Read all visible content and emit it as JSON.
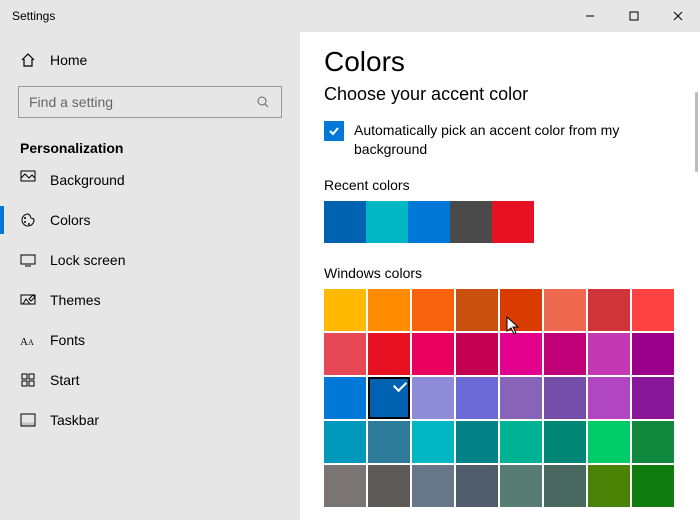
{
  "titlebar": {
    "title": "Settings"
  },
  "sidebar": {
    "home": "Home",
    "search_placeholder": "Find a setting",
    "category": "Personalization",
    "items": [
      {
        "label": "Background",
        "active": false,
        "cut": true
      },
      {
        "label": "Colors",
        "active": true
      },
      {
        "label": "Lock screen",
        "active": false
      },
      {
        "label": "Themes",
        "active": false
      },
      {
        "label": "Fonts",
        "active": false
      },
      {
        "label": "Start",
        "active": false
      },
      {
        "label": "Taskbar",
        "active": false
      }
    ]
  },
  "main": {
    "heading": "Colors",
    "subheading": "Choose your accent color",
    "auto_pick_label": "Automatically pick an accent color from my background",
    "auto_pick_checked": true,
    "recent_label": "Recent colors",
    "recent_colors": [
      "#0063b1",
      "#00b7c3",
      "#0078d7",
      "#4a4a4a",
      "#e81123"
    ],
    "windows_label": "Windows colors",
    "windows_colors": [
      [
        "#ffb900",
        "#ff8c00",
        "#f7630c",
        "#ca5010",
        "#da3b01",
        "#ef6950",
        "#d13438",
        "#ff4343"
      ],
      [
        "#e74856",
        "#e81123",
        "#ea005e",
        "#c30052",
        "#e3008c",
        "#bf0077",
        "#c239b3",
        "#9a0089"
      ],
      [
        "#0078d7",
        "#0063b1",
        "#8e8cd8",
        "#6b69d6",
        "#8764b8",
        "#744da9",
        "#b146c2",
        "#881798"
      ],
      [
        "#0099bc",
        "#2d7d9a",
        "#00b7c3",
        "#038387",
        "#00b294",
        "#018574",
        "#00cc6a",
        "#10893e"
      ],
      [
        "#7a7574",
        "#5d5a58",
        "#68768a",
        "#515c6b",
        "#567c73",
        "#486860",
        "#498205",
        "#107c10"
      ]
    ],
    "selected_row": 2,
    "selected_col": 1
  }
}
